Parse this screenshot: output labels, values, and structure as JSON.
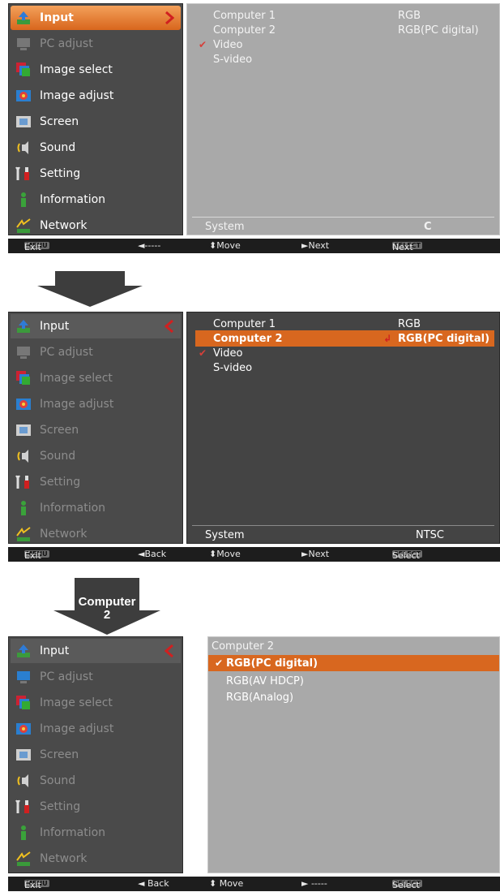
{
  "screen1": {
    "menu": [
      {
        "label": "Input",
        "icon": "input-icon",
        "state": "selected"
      },
      {
        "label": "PC adjust",
        "icon": "pc-adjust-icon",
        "state": "dim"
      },
      {
        "label": "Image select",
        "icon": "image-select-icon",
        "state": "normal"
      },
      {
        "label": "Image adjust",
        "icon": "image-adjust-icon",
        "state": "normal"
      },
      {
        "label": "Screen",
        "icon": "screen-icon",
        "state": "normal"
      },
      {
        "label": "Sound",
        "icon": "sound-icon",
        "state": "normal"
      },
      {
        "label": "Setting",
        "icon": "setting-icon",
        "state": "normal"
      },
      {
        "label": "Information",
        "icon": "information-icon",
        "state": "normal"
      },
      {
        "label": "Network",
        "icon": "network-icon",
        "state": "normal"
      }
    ],
    "panel": {
      "rows": [
        {
          "label": "Computer 1",
          "value": "RGB"
        },
        {
          "label": "Computer 2",
          "value": "RGB(PC digital)"
        },
        {
          "label": "Video",
          "value": "",
          "checked": true
        },
        {
          "label": "S-video",
          "value": ""
        }
      ],
      "system_label": "System",
      "system_value": "C"
    },
    "status": {
      "exit": "Exit",
      "exit_key": "MENU",
      "back": "◄-----",
      "move": "⬍Move",
      "next": "►Next",
      "select_key": "SELECT",
      "select": "Next"
    }
  },
  "screen2": {
    "menu": [
      {
        "label": "Input",
        "icon": "input-icon"
      },
      {
        "label": "PC adjust",
        "icon": "pc-adjust-icon"
      },
      {
        "label": "Image select",
        "icon": "image-select-icon"
      },
      {
        "label": "Image adjust",
        "icon": "image-adjust-icon"
      },
      {
        "label": "Screen",
        "icon": "screen-icon"
      },
      {
        "label": "Sound",
        "icon": "sound-icon"
      },
      {
        "label": "Setting",
        "icon": "setting-icon"
      },
      {
        "label": "Information",
        "icon": "information-icon"
      },
      {
        "label": "Network",
        "icon": "network-icon"
      }
    ],
    "panel": {
      "rows": [
        {
          "label": "Computer 1",
          "value": "RGB"
        },
        {
          "label": "Computer 2",
          "value": "RGB(PC digital)",
          "highlight": true
        },
        {
          "label": "Video",
          "value": "",
          "checked": true
        },
        {
          "label": "S-video",
          "value": ""
        }
      ],
      "system_label": "System",
      "system_value": "NTSC"
    },
    "status": {
      "exit": "Exit",
      "exit_key": "MENU",
      "back": "◄Back",
      "move": "⬍Move",
      "next": "►Next",
      "select_key": "SELECT",
      "select": "Select"
    }
  },
  "arrow_label": "Computer 2",
  "screen3": {
    "menu": [
      {
        "label": "Input",
        "icon": "input-icon"
      },
      {
        "label": "PC adjust",
        "icon": "pc-adjust-icon"
      },
      {
        "label": "Image select",
        "icon": "image-select-icon"
      },
      {
        "label": "Image adjust",
        "icon": "image-adjust-icon"
      },
      {
        "label": "Screen",
        "icon": "screen-icon"
      },
      {
        "label": "Sound",
        "icon": "sound-icon"
      },
      {
        "label": "Setting",
        "icon": "setting-icon"
      },
      {
        "label": "Information",
        "icon": "information-icon"
      },
      {
        "label": "Network",
        "icon": "network-icon"
      }
    ],
    "panel": {
      "title": "Computer 2",
      "rows": [
        {
          "label": "RGB(PC digital)",
          "checked": true,
          "highlight": true
        },
        {
          "label": "RGB(AV HDCP)"
        },
        {
          "label": "RGB(Analog)"
        }
      ]
    },
    "status": {
      "exit": "Exit",
      "exit_key": "MENU",
      "back": "◄ Back",
      "move": "⬍ Move",
      "next": "► -----",
      "select_key": "SELECT",
      "select": "Select"
    }
  },
  "colors": {
    "accent": "#d8671f",
    "menu_bg": "#4a4a4a",
    "panel_light": "#a9a9a9",
    "panel_dark": "#444444",
    "status_bar": "#1d1d1d",
    "check": "#d6403a"
  }
}
